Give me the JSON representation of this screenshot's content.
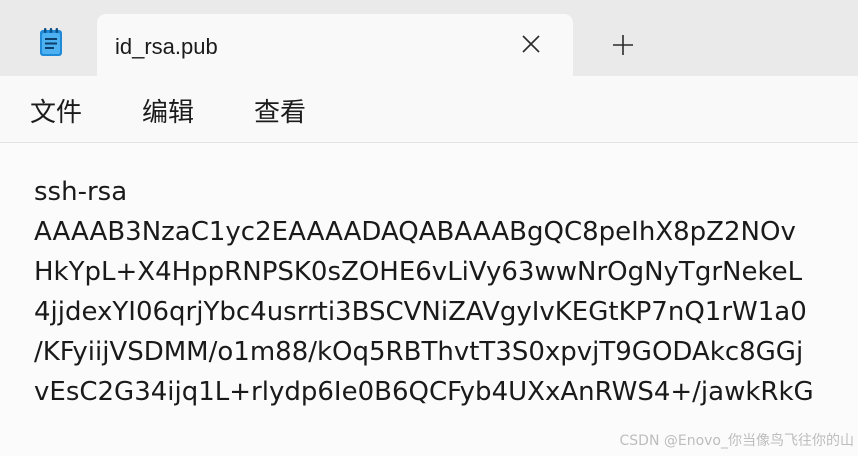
{
  "tab": {
    "title": "id_rsa.pub",
    "close_icon": "close-icon",
    "new_tab_icon": "plus-icon"
  },
  "app_icon": "notepad-icon",
  "menu": {
    "items": [
      "文件",
      "编辑",
      "查看"
    ]
  },
  "editor": {
    "lines": [
      "ssh-rsa",
      "AAAAB3NzaC1yc2EAAAADAQABAAABgQC8peIhX8pZ2NOv",
      "HkYpL+X4HppRNPSK0sZOHE6vLiVy63wwNrOgNyTgrNekeL",
      "4jjdexYI06qrjYbc4usrrti3BSCVNiZAVgyIvKEGtKP7nQ1rW1a0",
      "/KFyiijVSDMM/o1m88/kOq5RBThvtT3S0xpvjT9GODAkc8GGj",
      "vEsC2G34ijq1L+rlydp6Ie0B6QCFyb4UXxAnRWS4+/jawkRkG"
    ]
  },
  "watermark": "CSDN @Enovo_你当像鸟飞往你的山"
}
